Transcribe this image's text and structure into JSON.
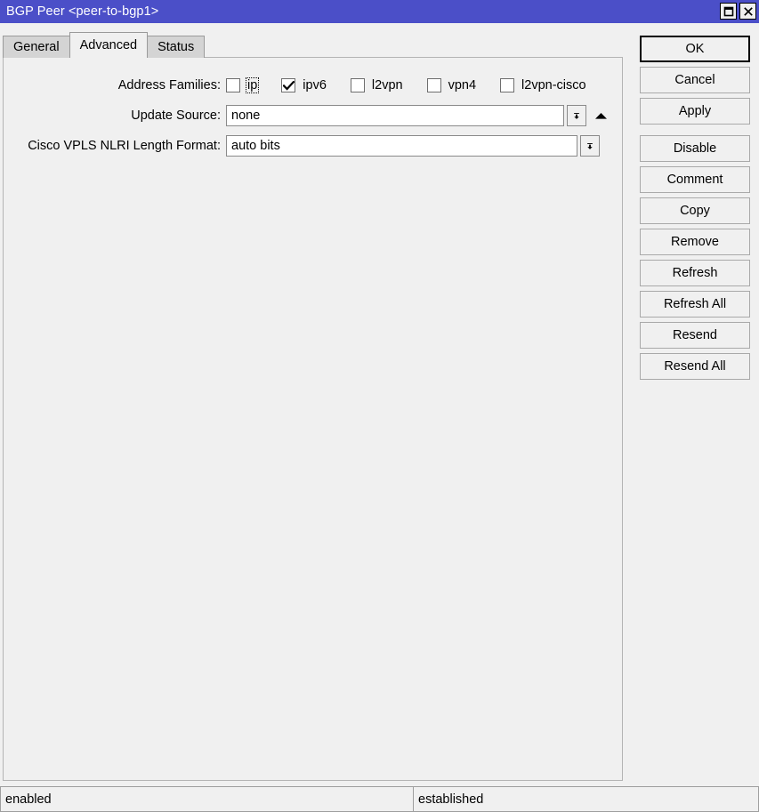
{
  "window": {
    "title": "BGP Peer <peer-to-bgp1>",
    "controls": [
      {
        "name": "maximize-button",
        "icon": "maximize-icon"
      },
      {
        "name": "close-button",
        "icon": "close-icon"
      }
    ]
  },
  "tabs": [
    {
      "label": "General",
      "active": false
    },
    {
      "label": "Advanced",
      "active": true
    },
    {
      "label": "Status",
      "active": false
    }
  ],
  "form": {
    "address_families": {
      "label": "Address Families:",
      "options": [
        {
          "label": "ip",
          "checked": false,
          "focused": true
        },
        {
          "label": "ipv6",
          "checked": true,
          "focused": false
        },
        {
          "label": "l2vpn",
          "checked": false,
          "focused": false
        },
        {
          "label": "vpn4",
          "checked": false,
          "focused": false
        },
        {
          "label": "l2vpn-cisco",
          "checked": false,
          "focused": false
        }
      ]
    },
    "update_source": {
      "label": "Update Source:",
      "value": "none",
      "dropdown_icon": "dropdown-arrow-icon",
      "collapse_icon": "up-arrow-icon"
    },
    "cisco_vpls_nlri": {
      "label": "Cisco VPLS NLRI Length Format:",
      "value": "auto bits",
      "dropdown_icon": "dropdown-arrow-icon"
    }
  },
  "buttons": [
    {
      "label": "OK",
      "name": "ok-button",
      "default": true,
      "gap_above": false
    },
    {
      "label": "Cancel",
      "name": "cancel-button",
      "default": false,
      "gap_above": false
    },
    {
      "label": "Apply",
      "name": "apply-button",
      "default": false,
      "gap_above": false
    },
    {
      "label": "Disable",
      "name": "disable-button",
      "default": false,
      "gap_above": true
    },
    {
      "label": "Comment",
      "name": "comment-button",
      "default": false,
      "gap_above": false
    },
    {
      "label": "Copy",
      "name": "copy-button",
      "default": false,
      "gap_above": false
    },
    {
      "label": "Remove",
      "name": "remove-button",
      "default": false,
      "gap_above": false
    },
    {
      "label": "Refresh",
      "name": "refresh-button",
      "default": false,
      "gap_above": false
    },
    {
      "label": "Refresh All",
      "name": "refresh-all-button",
      "default": false,
      "gap_above": false
    },
    {
      "label": "Resend",
      "name": "resend-button",
      "default": false,
      "gap_above": false
    },
    {
      "label": "Resend All",
      "name": "resend-all-button",
      "default": false,
      "gap_above": false
    }
  ],
  "statusbar": {
    "left": "enabled",
    "right": "established"
  },
  "colors": {
    "titlebar": "#4b4fc8",
    "window_background": "#f0f0f0",
    "tab_inactive": "#d4d4d4",
    "field_background": "#ffffff"
  }
}
